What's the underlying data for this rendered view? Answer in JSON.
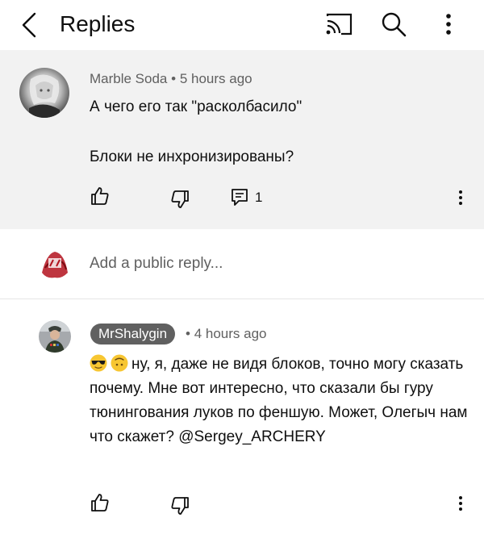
{
  "header": {
    "title": "Replies",
    "icons": [
      "back-arrow-icon",
      "cast-icon",
      "search-icon",
      "more-vert-icon"
    ]
  },
  "parent_comment": {
    "author": "Marble Soda",
    "separator": "•",
    "time": "5 hours ago",
    "line1": "А чего его так \"расколбасило\"",
    "line2": "Блоки не инхронизированы?",
    "reply_count": "1"
  },
  "reply_input": {
    "placeholder": "Add a public reply..."
  },
  "reply": {
    "author": "MrShalygin",
    "separator": "•",
    "time": "4 hours ago",
    "emojis": [
      "sunglasses-emoji",
      "upside-down-face-emoji"
    ],
    "text": "ну, я, даже не видя блоков, точно могу сказать почему. Мне вот интересно, что сказали бы гуру тюнингования луков по феншую. Может, Олегыч нам что скажет? @Sergey_ARCHERY"
  },
  "colors": {
    "highlight_bg": "#f2f2f2",
    "secondary_text": "#606060",
    "author_chip_bg": "#606060"
  }
}
